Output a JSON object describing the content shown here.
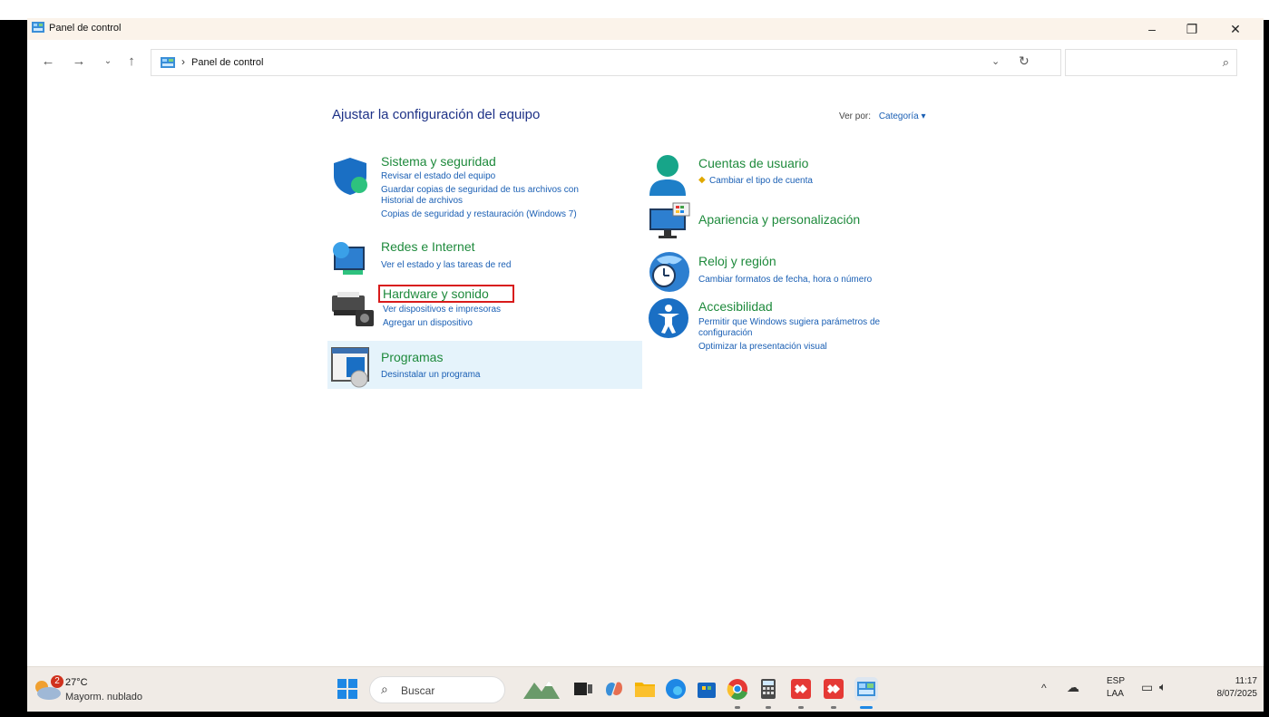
{
  "window": {
    "title": "Panel de control",
    "controls": {
      "minimize": "–",
      "maximize": "❐",
      "close": "✕"
    }
  },
  "nav": {
    "back_icon": "arrow-left-icon",
    "forward_icon": "arrow-right-icon",
    "recent_icon": "chevron-down-icon",
    "up_icon": "arrow-up-icon",
    "breadcrumb": [
      "Panel de control"
    ],
    "search_placeholder": ""
  },
  "main": {
    "heading": "Ajustar la configuración del equipo",
    "view_by_label": "Ver por:",
    "view_by_value": "Categoría"
  },
  "categories_left": [
    {
      "title": "Sistema y seguridad",
      "icon": "shield-icon",
      "links": [
        "Revisar el estado del equipo",
        "Guardar copias de seguridad de tus archivos con",
        "Historial de archivos",
        "Copias de seguridad y restauración (Windows 7)"
      ]
    },
    {
      "title": "Redes e Internet",
      "icon": "network-globe-icon",
      "links": [
        "Ver el estado y las tareas de red"
      ]
    },
    {
      "title": "Hardware y sonido",
      "icon": "printer-icon",
      "links": [
        "Ver dispositivos e impresoras",
        "Agregar un dispositivo"
      ]
    },
    {
      "title": "Programas",
      "icon": "programs-icon",
      "links": [
        "Desinstalar un programa"
      ]
    }
  ],
  "categories_right": [
    {
      "title": "Cuentas de usuario",
      "icon": "user-icon",
      "links": [
        "Cambiar el tipo de cuenta"
      ]
    },
    {
      "title": "Apariencia y personalización",
      "icon": "monitor-icon",
      "links": []
    },
    {
      "title": "Reloj y región",
      "icon": "clock-globe-icon",
      "links": [
        "Cambiar formatos de fecha, hora o número"
      ]
    },
    {
      "title": "Accesibilidad",
      "icon": "accessibility-icon",
      "links": [
        "Permitir que Windows sugiera parámetros de",
        "configuración",
        "Optimizar la presentación visual"
      ]
    }
  ],
  "taskbar": {
    "weather": {
      "badge": "2",
      "temp": "27°C",
      "condition": "Mayorm. nublado"
    },
    "search_label": "Buscar",
    "apps": [
      "start-icon",
      "mountains-icon",
      "task-view-icon",
      "copilot-icon",
      "file-explorer-icon",
      "edge-icon",
      "store-icon",
      "chrome-icon",
      "calculator-icon",
      "anydesk-icon",
      "anydesk-icon",
      "control-panel-icon"
    ],
    "tray": {
      "lang_top": "ESP",
      "lang_bottom": "LAA",
      "time": "11:17",
      "date": "8/07/2025"
    }
  },
  "colors": {
    "title_green": "#1e8a3c",
    "link_blue": "#1a5fb4",
    "heading_blue": "#1e3287",
    "highlight_red": "#d81b1b",
    "selected_bg": "#e5f3fb"
  }
}
